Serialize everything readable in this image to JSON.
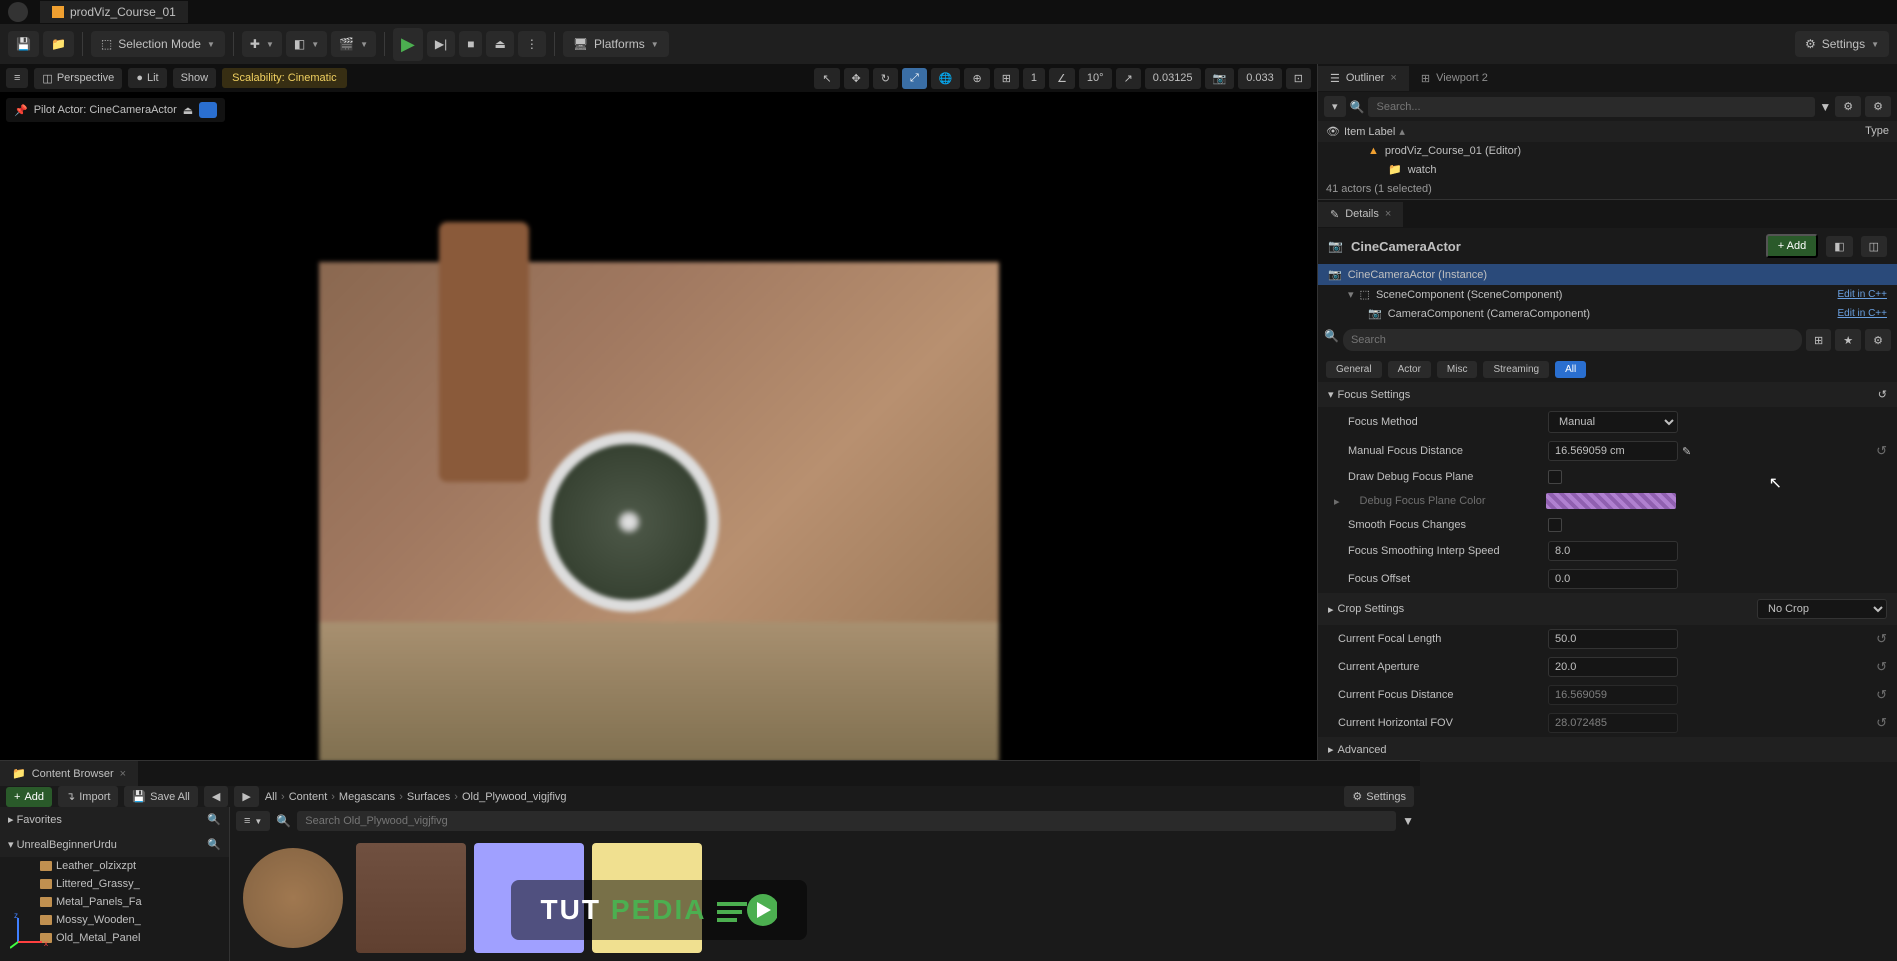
{
  "titlebar": {
    "project": "prodViz_Course_01"
  },
  "toolbar": {
    "mode": "Selection Mode",
    "platforms": "Platforms",
    "settings": "Settings"
  },
  "viewport": {
    "menu": "≡",
    "perspective": "Perspective",
    "lit": "Lit",
    "show": "Show",
    "scalability": "Scalability: Cinematic",
    "snap_val": "1",
    "angle": "10°",
    "scale": "0.03125",
    "speed": "0.033",
    "pilot": "Pilot Actor: CineCameraActor"
  },
  "overlay": {
    "tut": "TUT",
    "pedia": "PEDIA"
  },
  "content_browser": {
    "title": "Content Browser",
    "add": "Add",
    "import": "Import",
    "save_all": "Save All",
    "settings": "Settings",
    "breadcrumb": [
      "All",
      "Content",
      "Megascans",
      "Surfaces",
      "Old_Plywood_vigjfivg"
    ],
    "favorites": "Favorites",
    "root": "UnrealBeginnerUrdu",
    "folders": [
      "Leather_olzixzpt",
      "Littered_Grassy_",
      "Metal_Panels_Fa",
      "Mossy_Wooden_",
      "Old_Metal_Panel"
    ],
    "search_placeholder": "Search Old_Plywood_vigjfivg"
  },
  "outliner": {
    "title": "Outliner",
    "viewport2": "Viewport 2",
    "search_placeholder": "Search...",
    "col_item": "Item Label",
    "col_type": "Type",
    "rows": [
      {
        "label": "prodViz_Course_01 (Editor)",
        "indent": 0
      },
      {
        "label": "watch",
        "indent": 1
      }
    ],
    "status": "41 actors (1 selected)"
  },
  "details": {
    "title": "Details",
    "actor_name": "CineCameraActor",
    "add": "Add",
    "instance": "CineCameraActor (Instance)",
    "components": [
      {
        "label": "SceneComponent (SceneComponent)",
        "edit": "Edit in C++"
      },
      {
        "label": "CameraComponent (CameraComponent)",
        "edit": "Edit in C++"
      }
    ],
    "search_placeholder": "Search",
    "filters": [
      "General",
      "Actor",
      "Misc",
      "Streaming",
      "All"
    ],
    "active_filter": "All",
    "cat_focus": "Focus Settings",
    "cat_crop": "Crop Settings",
    "cat_advanced": "Advanced",
    "props": {
      "focus_method": {
        "label": "Focus Method",
        "value": "Manual"
      },
      "manual_focus_distance": {
        "label": "Manual Focus Distance",
        "value": "16.569059 cm"
      },
      "draw_debug": {
        "label": "Draw Debug Focus Plane"
      },
      "debug_color": {
        "label": "Debug Focus Plane Color"
      },
      "smooth_changes": {
        "label": "Smooth Focus Changes"
      },
      "smooth_speed": {
        "label": "Focus Smoothing Interp Speed",
        "value": "8.0"
      },
      "focus_offset": {
        "label": "Focus Offset",
        "value": "0.0"
      },
      "crop": {
        "value": "No Crop"
      },
      "focal_length": {
        "label": "Current Focal Length",
        "value": "50.0"
      },
      "aperture": {
        "label": "Current Aperture",
        "value": "20.0"
      },
      "focus_distance": {
        "label": "Current Focus Distance",
        "value": "16.569059"
      },
      "hfov": {
        "label": "Current Horizontal FOV",
        "value": "28.072485"
      }
    }
  }
}
